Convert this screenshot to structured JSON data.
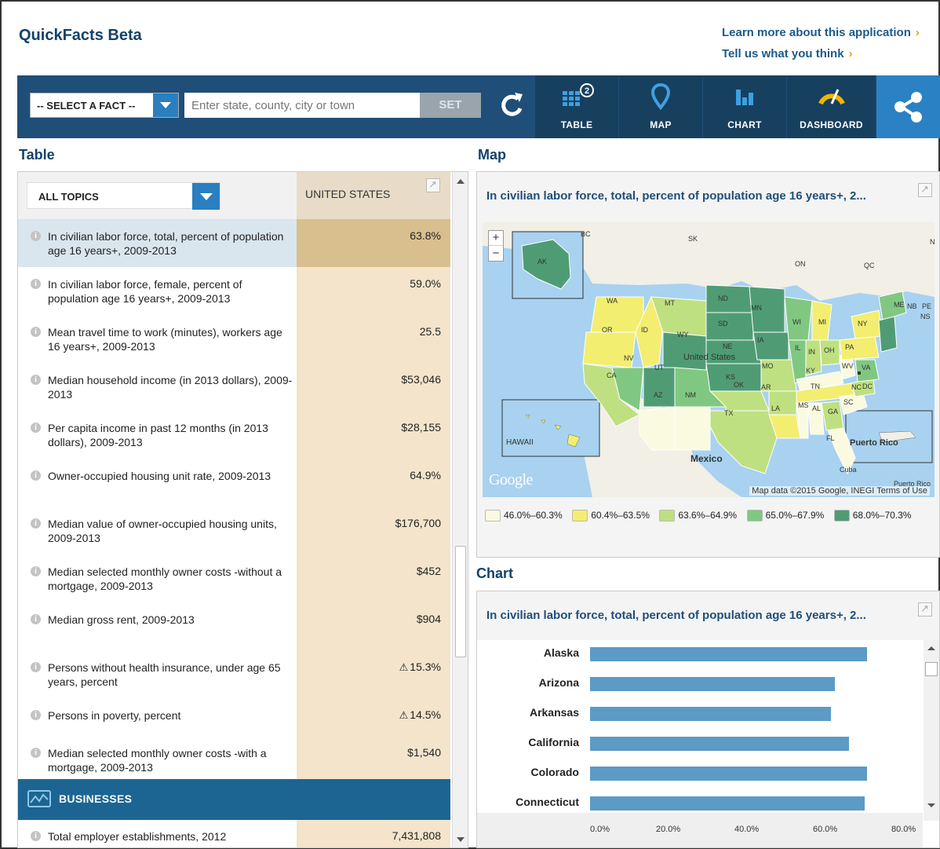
{
  "header": {
    "title": "QuickFacts Beta",
    "link_learn": "Learn more about this application",
    "link_tell": "Tell us what you think"
  },
  "toolbar": {
    "select_fact": "-- SELECT A FACT --",
    "location_placeholder": "Enter state, county, city or town",
    "set_label": "SET",
    "table_label": "TABLE",
    "table_badge": "2",
    "map_label": "MAP",
    "chart_label": "CHART",
    "dashboard_label": "DASHBOARD"
  },
  "sections": {
    "table": "Table",
    "map": "Map",
    "chart": "Chart"
  },
  "table": {
    "topics_label": "ALL TOPICS",
    "column_header": "UNITED STATES",
    "rows": [
      {
        "label": "In civilian labor force, total, percent of population age 16 years+, 2009-2013",
        "value": "63.8%"
      },
      {
        "label": "In civilian labor force, female, percent of population age 16 years+, 2009-2013",
        "value": "59.0%"
      },
      {
        "label": "Mean travel time to work (minutes), workers age 16 years+, 2009-2013",
        "value": "25.5"
      },
      {
        "label": "Median household income (in 2013 dollars), 2009-2013",
        "value": "$53,046"
      },
      {
        "label": "Per capita income in past 12 months (in 2013 dollars), 2009-2013",
        "value": "$28,155"
      },
      {
        "label": "Owner-occupied housing unit rate, 2009-2013",
        "value": "64.9%"
      },
      {
        "label": "Median value of owner-occupied housing units, 2009-2013",
        "value": "$176,700"
      },
      {
        "label": "Median selected monthly owner costs -without a mortgage, 2009-2013",
        "value": "$452"
      },
      {
        "label": "Median gross rent, 2009-2013",
        "value": "$904"
      },
      {
        "label": "Persons without health insurance, under age 65 years, percent",
        "value": "15.3%"
      },
      {
        "label": "Persons in poverty, percent",
        "value": "14.5%"
      },
      {
        "label": "Median selected monthly owner costs -with a mortgage, 2009-2013",
        "value": "$1,540"
      }
    ],
    "warn_symbol": "⚠",
    "section_label": "BUSINESSES",
    "last_row": {
      "label": "Total employer establishments, 2012",
      "value": "7,431,808"
    }
  },
  "map": {
    "title": "In civilian labor force, total, percent of population age 16 years+, 2...",
    "zoom_in": "+",
    "zoom_out": "−",
    "labels": {
      "BC": "BC",
      "SK": "SK",
      "ON": "ON",
      "QC": "QC",
      "NB": "NB",
      "PE": "PE",
      "NS": "NS",
      "N": "N",
      "AK": "AK",
      "HAWAII": "HAWAII",
      "Mexico": "Mexico",
      "Cuba": "Cuba",
      "PR": "Puerto Rico",
      "PR_small": "Puerto Rico",
      "US": "United States",
      "DC": "DC",
      "WA": "WA",
      "OR": "OR",
      "ID": "ID",
      "MT": "MT",
      "WY": "WY",
      "NV": "NV",
      "UT": "UT",
      "CA": "CA",
      "AZ": "AZ",
      "NM": "NM",
      "ND": "ND",
      "SD": "SD",
      "NE": "NE",
      "KS": "KS",
      "OK": "OK",
      "TX": "TX",
      "MN": "MN",
      "IA": "IA",
      "MO": "MO",
      "AR": "AR",
      "LA": "LA",
      "WI": "WI",
      "IL": "IL",
      "MI": "MI",
      "IN": "IN",
      "OH": "OH",
      "KY": "KY",
      "TN": "TN",
      "MS": "MS",
      "AL": "AL",
      "GA": "GA",
      "FL": "FL",
      "SC": "SC",
      "NC": "NC",
      "VA": "VA",
      "WV": "WV",
      "PA": "PA",
      "NY": "NY",
      "ME": "ME"
    },
    "google": "Google",
    "attribution": "Map data ©2015 Google, INEGI   Terms of Use",
    "legend": [
      {
        "label": "46.0%–60.3%",
        "color": "#fafae0"
      },
      {
        "label": "60.4%–63.5%",
        "color": "#f3ee70"
      },
      {
        "label": "63.6%–64.9%",
        "color": "#bfe080"
      },
      {
        "label": "65.0%–67.9%",
        "color": "#80c882"
      },
      {
        "label": "68.0%–70.3%",
        "color": "#4f9c74"
      }
    ]
  },
  "chart": {
    "title": "In civilian labor force, total, percent of population age 16 years+, 2..."
  },
  "chart_data": {
    "type": "bar",
    "orientation": "horizontal",
    "categories": [
      "Alaska",
      "Arizona",
      "Arkansas",
      "California",
      "Colorado",
      "Connecticut"
    ],
    "values": [
      70.5,
      62.4,
      61.4,
      66.0,
      70.5,
      69.9
    ],
    "xlim": [
      0,
      80
    ],
    "ticks": [
      "0.0%",
      "20.0%",
      "40.0%",
      "60.0%",
      "80.0%"
    ],
    "tick_values": [
      0,
      20,
      40,
      60,
      80
    ],
    "bar_color": "#5b9bc6",
    "grid": false
  }
}
